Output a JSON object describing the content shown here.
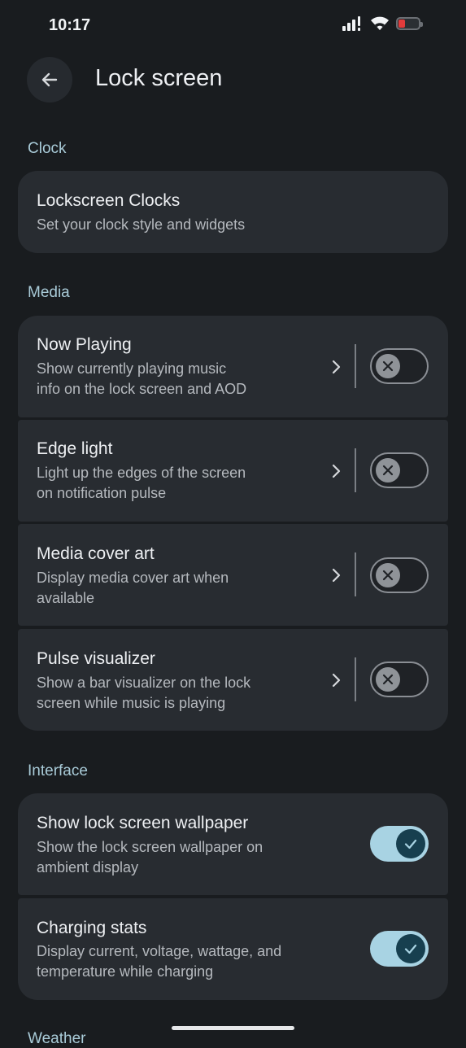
{
  "status": {
    "time": "10:17"
  },
  "header": {
    "title": "Lock screen"
  },
  "sections": {
    "clock": "Clock",
    "media": "Media",
    "interface": "Interface",
    "weather": "Weather"
  },
  "clock_card": {
    "title": "Lockscreen Clocks",
    "subtitle": "Set your clock style and widgets"
  },
  "media_items": [
    {
      "title": "Now Playing",
      "sub1": "Show currently playing music",
      "sub2": "info on the lock screen and AOD",
      "enabled": false
    },
    {
      "title": "Edge light",
      "sub1": "Light up the edges of the screen",
      "sub2": "on notification pulse",
      "enabled": false
    },
    {
      "title": "Media cover art",
      "sub1": "Display media cover art when",
      "sub2": "available",
      "enabled": false
    },
    {
      "title": "Pulse visualizer",
      "sub1": "Show a bar visualizer on the lock",
      "sub2": "screen while music is playing",
      "enabled": false
    }
  ],
  "interface_items": [
    {
      "title": "Show lock screen wallpaper",
      "sub1": "Show the lock screen wallpaper on",
      "sub2": "ambient display",
      "enabled": true
    },
    {
      "title": "Charging stats",
      "sub1": "Display current, voltage, wattage, and",
      "sub2": "temperature while charging",
      "enabled": true
    }
  ],
  "colors": {
    "accent": "#a8d3e3",
    "background": "#191c1f",
    "card": "#282c31",
    "battery_low": "#e23b3b"
  },
  "icons": {
    "back": "arrow-left-icon",
    "chevron": "chevron-right-icon",
    "toggle_off": "close-icon",
    "toggle_on": "check-icon"
  }
}
